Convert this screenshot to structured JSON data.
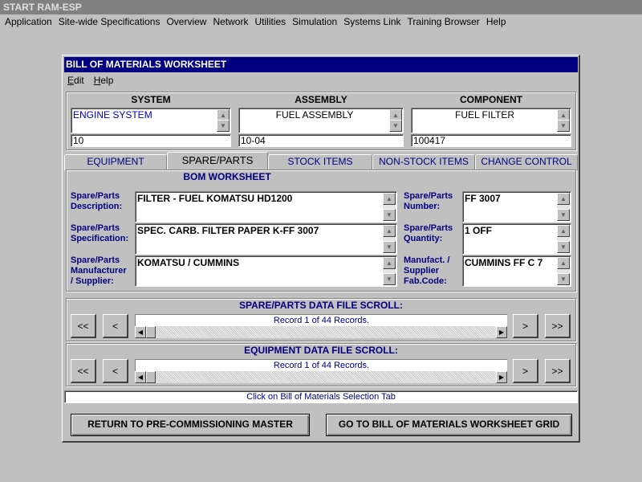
{
  "app": {
    "title": "START RAM-ESP",
    "menu": [
      "Application",
      "Site-wide Specifications",
      "Overview",
      "Network",
      "Utilities",
      "Simulation",
      "Systems Link",
      "Training Browser",
      "Help"
    ]
  },
  "window": {
    "title": "BILL OF MATERIALS WORKSHEET",
    "menu": [
      "Edit",
      "Help"
    ]
  },
  "header": {
    "system": {
      "label": "SYSTEM",
      "value": "ENGINE SYSTEM",
      "code": "10"
    },
    "assembly": {
      "label": "ASSEMBLY",
      "value": "FUEL ASSEMBLY",
      "code": "10-04"
    },
    "component": {
      "label": "COMPONENT",
      "value": "FUEL FILTER",
      "code": "100417"
    }
  },
  "tabs": [
    "EQUIPMENT",
    "SPARE/PARTS",
    "STOCK ITEMS",
    "NON-STOCK ITEMS",
    "CHANGE CONTROL"
  ],
  "bom": {
    "title": "BOM WORKSHEET",
    "fields": {
      "description": {
        "label1": "Spare/Parts",
        "label2": "Description:",
        "value": "FILTER - FUEL KOMATSU HD1200"
      },
      "specification": {
        "label1": "Spare/Parts",
        "label2": "Specification:",
        "value": "SPEC. CARB. FILTER PAPER K-FF 3007"
      },
      "manufacturer": {
        "label1": "Spare/Parts",
        "label2": "Manufacturer",
        "label3": "/ Supplier:",
        "value": "KOMATSU / CUMMINS"
      },
      "number": {
        "label1": "Spare/Parts",
        "label2": "Number:",
        "value": "FF 3007"
      },
      "quantity": {
        "label1": "Spare/Parts",
        "label2": "Quantity:",
        "value": "1 OFF"
      },
      "fabcode": {
        "label1": "Manufact. /",
        "label2": "Supplier",
        "label3": "Fab.Code:",
        "value": "CUMMINS FF C 7"
      }
    }
  },
  "spare_scroll": {
    "title": "SPARE/PARTS DATA FILE SCROLL:",
    "record": "Record 1 of 44 Records.",
    "buttons": [
      "<<",
      "<",
      ">",
      ">>"
    ]
  },
  "equipment_scroll": {
    "title": "EQUIPMENT DATA FILE SCROLL:",
    "record": "Record 1 of 44 Records.",
    "buttons": [
      "<<",
      "<",
      ">",
      ">>"
    ]
  },
  "status": "Click on Bill of Materials Selection Tab",
  "actions": {
    "return": "RETURN TO PRE-COMMISSIONING MASTER",
    "grid": "GO TO BILL OF MATERIALS WORKSHEET GRID"
  }
}
